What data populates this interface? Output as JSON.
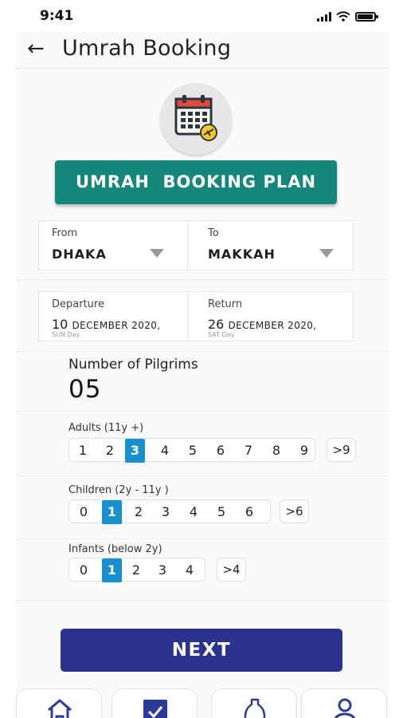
{
  "status_bar": {
    "time": "9:41"
  },
  "header": {
    "back_icon": "arrow-left-icon",
    "title": "Umrah Booking"
  },
  "hero_icon": "calendar-plane-icon",
  "plan_banner": "UMRAH  BOOKING PLAN",
  "route": {
    "from_label": "From",
    "from_value": "DHAKA",
    "to_label": "To",
    "to_value": "MAKKAH"
  },
  "dates": {
    "departure_label": "Departure",
    "departure_day": "10",
    "departure_month_year": "DECEMBER 2020,",
    "departure_weekday": "SUN Day",
    "return_label": "Return",
    "return_day": "26",
    "return_month_year": "DECEMBER 2020,",
    "return_weekday": "SAT Day"
  },
  "pilgrims": {
    "label": "Number of Pilgrims",
    "count": "05"
  },
  "adults": {
    "label": "Adults (11y +)",
    "options": [
      "1",
      "2",
      "3",
      "4",
      "5",
      "6",
      "7",
      "8",
      "9"
    ],
    "selected": "3",
    "more": ">9"
  },
  "children": {
    "label": "Children (2y - 11y )",
    "options": [
      "0",
      "1",
      "2",
      "3",
      "4",
      "5",
      "6"
    ],
    "selected": "1",
    "more": ">6"
  },
  "infants": {
    "label": "Infants (below 2y)",
    "options": [
      "0",
      "1",
      "2",
      "3",
      "4"
    ],
    "selected": "1",
    "more": ">4"
  },
  "next_button": "NEXT",
  "bottom_nav": [
    "home-icon",
    "checkbox-icon",
    "bottle-icon",
    "user-icon"
  ],
  "colors": {
    "banner": "#15877a",
    "selected": "#1a8fd0",
    "next": "#29338f",
    "nav_icon": "#2c3a9a"
  }
}
